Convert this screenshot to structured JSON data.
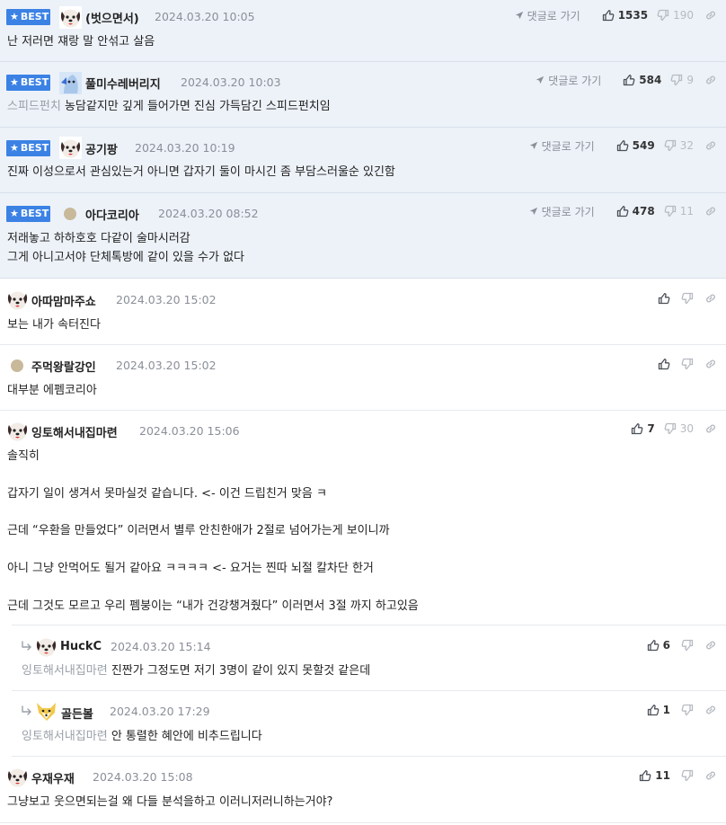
{
  "labels": {
    "best": "BEST",
    "goto_reply": "댓글로 가기"
  },
  "comments": [
    {
      "nick": "(벗으면서)",
      "date": "2024.03.20 10:05",
      "up": "1535",
      "down": "190",
      "body": "난 저러면 쟤랑 말 안섞고 살음"
    },
    {
      "nick": "풀미수레버리지",
      "date": "2024.03.20 10:03",
      "up": "584",
      "down": "9",
      "mention": "스피드펀치",
      "body": "농담같지만 깊게 들어가면 진심 가득담긴 스피드펀치임"
    },
    {
      "nick": "공기팡",
      "date": "2024.03.20 10:19",
      "up": "549",
      "down": "32",
      "body": "진짜 이성으로서 관심있는거 아니면 갑자기 둘이 마시긴 좀 부담스러울순 있긴함"
    },
    {
      "nick": "아다코리아",
      "date": "2024.03.20 08:52",
      "up": "478",
      "down": "11",
      "body_lines": [
        "저래놓고 하하호호 다같이 술마시러감",
        "그게 아니고서야 단체톡방에 같이 있을 수가 없다"
      ]
    },
    {
      "nick": "아따맘마주쇼",
      "date": "2024.03.20 15:02",
      "body": "보는 내가 속터진다"
    },
    {
      "nick": "주먹왕랄강인",
      "date": "2024.03.20 15:02",
      "body": "대부분 에펨코리아"
    },
    {
      "nick": "잉토해서내집마련",
      "date": "2024.03.20 15:06",
      "up": "7",
      "down": "30",
      "body_lines": [
        "솔직히",
        "갑자기 일이 생겨서 못마실것 같습니다. <- 이건 드립친거 맞음 ㅋ",
        "근데 “우환을 만들었다” 이러면서 별루 안친한애가 2절로 넘어가는게 보이니까",
        "아니 그냥 안먹어도 될거 같아요 ㅋㅋㅋㅋ <- 요거는 찐따 뇌절 칼차단 한거",
        "근데 그것도 모르고 우리 펨붕이는 “내가 건강챙겨줬다” 이러면서 3절 까지 하고있음"
      ]
    },
    {
      "nick": "HuckC",
      "date": "2024.03.20 15:14",
      "up": "6",
      "mention": "잉토해서내집마련",
      "body": "진짠가 그정도면 저기 3명이 같이 있지 못할것 같은데"
    },
    {
      "nick": "골든볼",
      "date": "2024.03.20 17:29",
      "up": "1",
      "mention": "잉토해서내집마련",
      "body": "안 통렬한 혜안에 비추드립니다"
    },
    {
      "nick": "우재우재",
      "date": "2024.03.20 15:08",
      "up": "11",
      "body": "그냥보고 웃으면되는걸 왜 다들 분석을하고 이러니저러니하는거야?"
    }
  ],
  "colors": {
    "best_bg": "#edf2f9",
    "badge": "#3b82e4",
    "muted": "#8a8f98"
  },
  "icons": [
    "star-icon",
    "paper-plane-icon",
    "thumbs-up-icon",
    "thumbs-down-icon",
    "link-icon",
    "reply-arrow-icon"
  ]
}
